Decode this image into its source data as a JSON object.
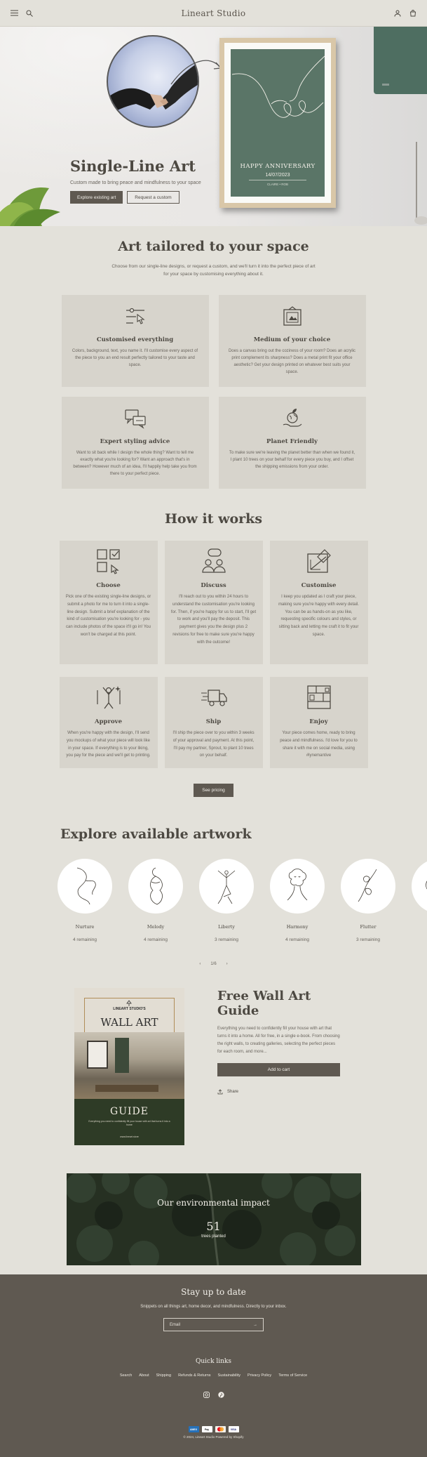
{
  "header": {
    "logo": "Lineart Studio",
    "icons": [
      "menu-icon",
      "search-icon",
      "account-icon",
      "cart-icon"
    ]
  },
  "hero": {
    "title": "Single-Line Art",
    "subtitle": "Custom made to bring peace and mindfulness to your space",
    "primary_button": "Explore existing art",
    "secondary_button": "Request a custom",
    "frame_heading": "HAPPY ANNIVERSARY",
    "frame_date": "14/07/2023",
    "frame_names": "CLAIRE • ROB"
  },
  "tailored": {
    "title": "Art tailored to your space",
    "lead_line1": "Choose from our single-line designs, or request a custom, and we'll turn it into the perfect piece of art",
    "lead_line2": "for your space by customising everything about it.",
    "cards": [
      {
        "icon": "customise-icon",
        "title": "Customised everything",
        "text": "Colors, background, text, you name it. I'll customise every aspect of the piece to you an end result perfectly tailored to your taste and space."
      },
      {
        "icon": "frame-icon",
        "title": "Medium of your choice",
        "text": "Does a canvas bring out the coziness of your room? Does an acrylic print complement its sharpness? Does a metal print fit your office aesthetic? Get your design printed on whatever best suits your space."
      },
      {
        "icon": "chat-icon",
        "title": "Expert styling advice",
        "text": "Want to sit back while I design the whole thing? Want to tell me exactly what you're looking for? Want an approach that's in between? However much of an idea, I'll happily help take you from there to your perfect piece."
      },
      {
        "icon": "planet-icon",
        "title": "Planet Friendly",
        "text": "To make sure we're leaving the planet better than when we found it, I plant 10 trees on your behalf for every piece you buy, and I offset the shipping emissions from your order."
      }
    ]
  },
  "how": {
    "title": "How it works",
    "steps": [
      {
        "icon": "choose-icon",
        "title": "Choose",
        "text": "Pick one of the existing single-line designs, or submit a photo for me to turn it into a single-line design. Submit a brief explanation of the kind of customisation you're looking for - you can include photos of the space it'll go in! You won't be charged at this point."
      },
      {
        "icon": "discuss-icon",
        "title": "Discuss",
        "text": "I'll reach out to you within 24 hours to understand the customisation you're looking for. Then, if you're happy for us to start, I'll get to work and you'll pay the deposit. This payment gives you the design plus 2 revisions for free to make sure you're happy with the outcome!"
      },
      {
        "icon": "drafting-icon",
        "title": "Customise",
        "text": "I keep you updated as I craft your piece, making sure you're happy with every detail. You can be as hands-on as you like, requesting specific colours and styles, or sitting back and letting me craft it to fit your space."
      },
      {
        "icon": "celebrate-icon",
        "title": "Approve",
        "text": "When you're happy with the design, I'll send you mockups of what your piece will look like in your space. If everything is to your liking, you pay for the piece and we'll get to printing."
      },
      {
        "icon": "truck-icon",
        "title": "Ship",
        "text": "I'll ship the piece over to you within 3 weeks of your approval and payment. At this point, I'll pay my partner, Sprout, to plant 10 trees on your behalf."
      },
      {
        "icon": "shelf-icon",
        "title": "Enjoy",
        "text": "Your piece comes home, ready to bring peace and mindfulness. I'd love for you to share it with me on social media, using #lynemantive"
      }
    ],
    "button": "See pricing"
  },
  "artwork": {
    "title": "Explore available artwork",
    "items": [
      {
        "name": "Nurture",
        "remaining": "4 remaining"
      },
      {
        "name": "Melody",
        "remaining": "4 remaining"
      },
      {
        "name": "Liberty",
        "remaining": "3 remaining"
      },
      {
        "name": "Harmony",
        "remaining": "4 remaining"
      },
      {
        "name": "Flutter",
        "remaining": "3 remaining"
      },
      {
        "name": "",
        "remaining": ""
      }
    ],
    "pager": {
      "prev": "‹",
      "label": "1/6",
      "next": "›"
    }
  },
  "guide": {
    "cover_brand": "LINEART STUDIO'S",
    "cover_title": "WALL ART",
    "cover_bottom": "GUIDE",
    "cover_sub": "Everything you need to confidently fill your house with art that turns it into a home",
    "cover_url": "www.lineart.store",
    "title": "Free Wall Art Guide",
    "description": "Everything you need to confidently fill your house with art that turns it into a home. All for free, in a single e-book. From choosing the right walls, to creating galleries, selecting the perfect pieces for each room, and more...",
    "button": "Add to cart",
    "share": "Share"
  },
  "impact": {
    "title": "Our environmental impact",
    "number": "51",
    "label": "trees planted"
  },
  "footer": {
    "title": "Stay up to date",
    "subtitle": "Snippets on all things art, home decor, and mindfulness. Directly to your inbox.",
    "email_placeholder": "Email",
    "quick_links_title": "Quick links",
    "links": [
      "Search",
      "About",
      "Shipping",
      "Refunds & Returns",
      "Sustainability",
      "Privacy Policy",
      "Terms of Service"
    ],
    "payments": [
      "AMEX",
      "Pay",
      "MC",
      "VISA"
    ],
    "copyright": "© 2024, Lineart Studio Powered by Shopify"
  },
  "colors": {
    "background": "#e3e1da",
    "card": "#d7d4cc",
    "dark": "#5f5951",
    "text": "#4d4942"
  }
}
